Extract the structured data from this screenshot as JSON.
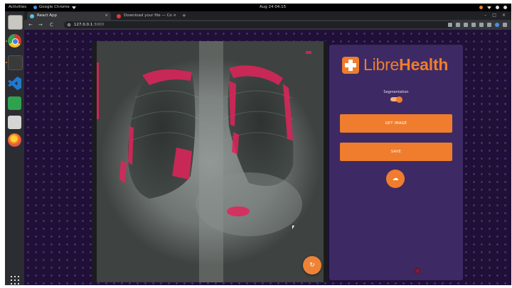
{
  "system": {
    "activities": "Activities",
    "app_menu": "Google Chrome",
    "clock": "Aug 24 04:15"
  },
  "browser": {
    "tabs": [
      {
        "title": "React App",
        "favicon_color": "#5bc0de"
      },
      {
        "title": "Download your file — Co",
        "favicon_color": "#e53935"
      }
    ],
    "new_tab": "+",
    "url": "127.0.0.1",
    "url_port": ":3000",
    "nav": {
      "back": "←",
      "forward": "→",
      "reload": "C"
    }
  },
  "panel": {
    "logo_light": "Libre",
    "logo_bold": "Health",
    "segmentation_label": "Segmentation",
    "segmentation_on": true,
    "get_image_label": "GET IMAGE",
    "save_label": "SAVE",
    "upload_icon": "cloud-upload-icon"
  },
  "viewer": {
    "reset_icon": "refresh-icon"
  },
  "colors": {
    "brand_orange": "#ef7d2d",
    "panel_bg": "#3d2a64",
    "page_bg": "#201038",
    "mask": "#e0245a"
  }
}
